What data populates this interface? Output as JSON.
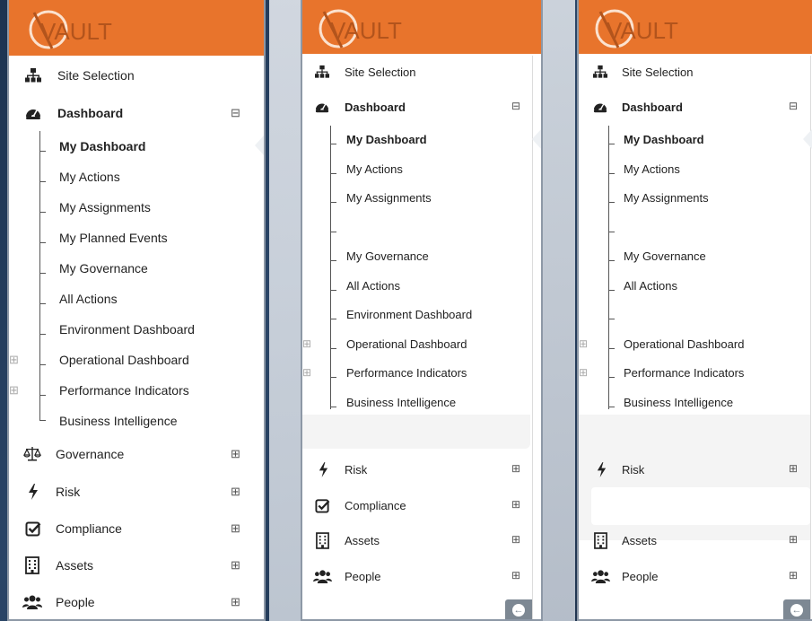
{
  "brand": {
    "logo_text": "VAULT",
    "header_color": "#e8742c"
  },
  "panel1": {
    "site_selection": "Site Selection",
    "dashboard": "Dashboard",
    "dashboard_toggle": "⊟",
    "sub_items": [
      "My Dashboard",
      "My Actions",
      "My Assignments",
      "My Planned Events",
      "My Governance",
      "All Actions",
      "Environment Dashboard",
      "Operational Dashboard",
      "Performance Indicators",
      "Business Intelligence"
    ],
    "governance": "Governance",
    "risk": "Risk",
    "compliance": "Compliance",
    "assets": "Assets",
    "people": "People",
    "expand_toggle": "⊞"
  },
  "panel2": {
    "site_selection": "Site Selection",
    "dashboard": "Dashboard",
    "dashboard_toggle": "⊟",
    "sub_items": [
      "My Dashboard",
      "My Actions",
      "My Assignments",
      "",
      "My Governance",
      "All Actions",
      "Environment Dashboard",
      "Operational Dashboard",
      "Performance Indicators",
      "Business Intelligence"
    ],
    "risk": "Risk",
    "compliance": "Compliance",
    "assets": "Assets",
    "people": "People",
    "expand_toggle": "⊞"
  },
  "panel3": {
    "site_selection": "Site Selection",
    "dashboard": "Dashboard",
    "dashboard_toggle": "⊟",
    "sub_items": [
      "My Dashboard",
      "My Actions",
      "My Assignments",
      "",
      "My Governance",
      "All Actions",
      "",
      "Operational Dashboard",
      "Performance Indicators",
      "Business Intelligence"
    ],
    "risk": "Risk",
    "assets": "Assets",
    "people": "People",
    "expand_toggle": "⊞"
  },
  "icons": {
    "site": "sitemap-icon",
    "dashboard": "tachometer-icon",
    "governance": "balance-scale-icon",
    "risk": "bolt-icon",
    "compliance": "check-square-icon",
    "assets": "building-icon",
    "people": "users-icon",
    "back": "arrow-left-circle-icon"
  }
}
